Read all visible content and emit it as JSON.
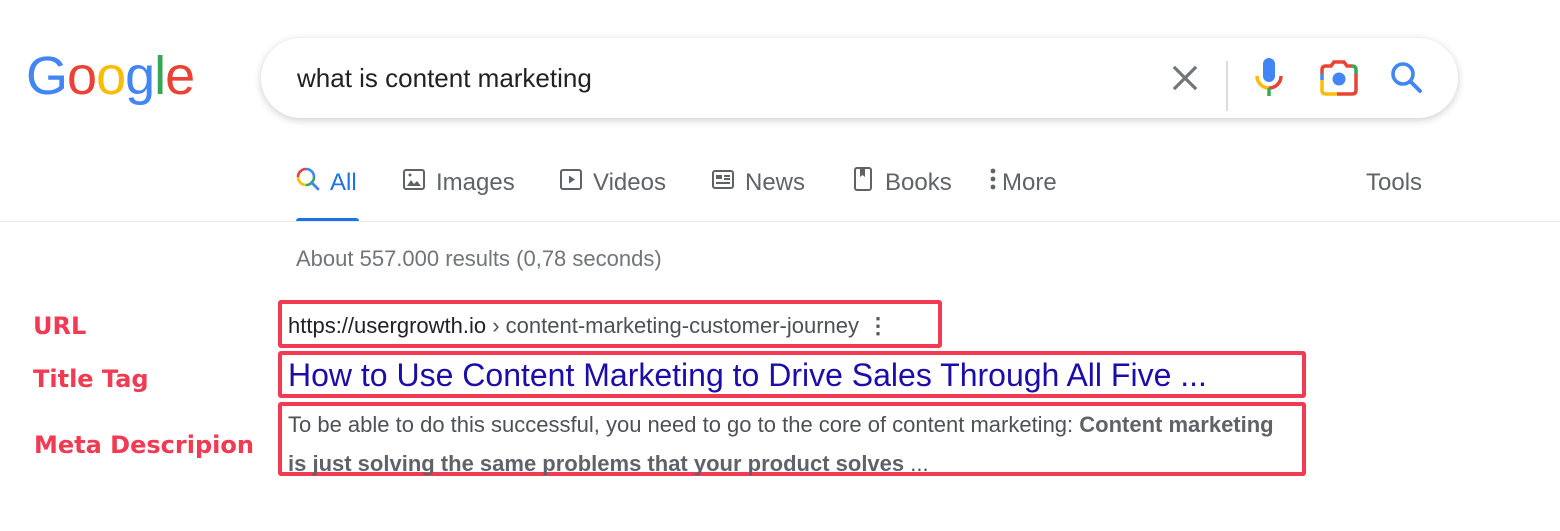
{
  "logo": {
    "letters": [
      "G",
      "o",
      "o",
      "g",
      "l",
      "e"
    ],
    "colors": [
      "#4285f4",
      "#ea4335",
      "#fbbc05",
      "#4285f4",
      "#34a853",
      "#ea4335"
    ]
  },
  "search": {
    "query": "what is content marketing",
    "clear_icon": "close-icon",
    "voice_icon": "microphone-icon",
    "lens_icon": "camera-lens-icon",
    "submit_icon": "search-icon"
  },
  "tabs": [
    {
      "label": "All",
      "icon": "search-icon",
      "active": true
    },
    {
      "label": "Images",
      "icon": "image-icon",
      "active": false
    },
    {
      "label": "Videos",
      "icon": "play-icon",
      "active": false
    },
    {
      "label": "News",
      "icon": "newspaper-icon",
      "active": false
    },
    {
      "label": "Books",
      "icon": "book-icon",
      "active": false
    },
    {
      "label": "More",
      "icon": "more-vertical-icon",
      "active": false
    }
  ],
  "tools_label": "Tools",
  "stats": "About 557.000 results (0,78 seconds)",
  "annotations": {
    "url": "URL",
    "title": "Title Tag",
    "meta": "Meta Descripion",
    "color": "#f23a52"
  },
  "result": {
    "domain": "https://usergrowth.io",
    "breadcrumb": " › content-marketing-customer-journey",
    "more_icon": "⋮",
    "title": "How to Use Content Marketing to Drive Sales Through All Five ...",
    "description_plain": "To be able to do this successful, you need to go to the core of content marketing: ",
    "description_bold": "Content marketing is just solving the same problems that your product solves",
    "description_tail": " ..."
  },
  "colors": {
    "accent_blue": "#1a73e8",
    "link_blue": "#1a0dab",
    "muted_gray": "#5f6368"
  }
}
